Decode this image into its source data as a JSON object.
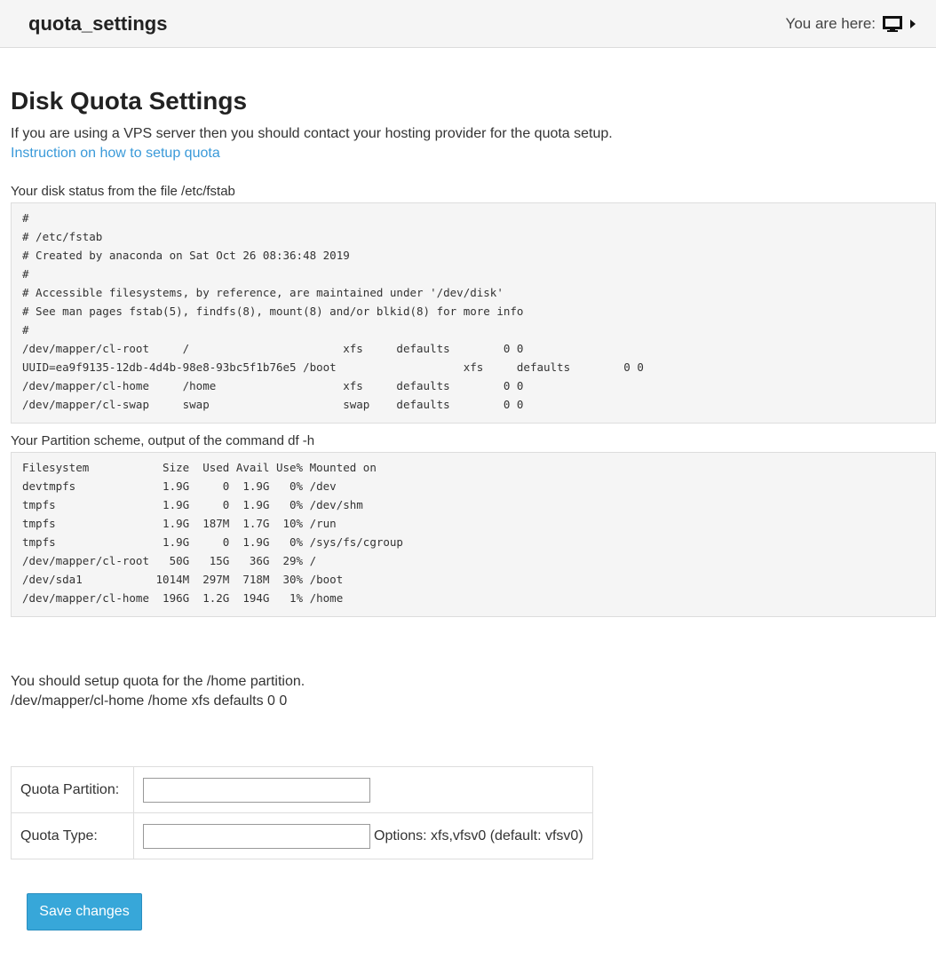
{
  "header": {
    "title": "quota_settings",
    "breadcrumb_label": "You are here:",
    "breadcrumb_icon": "desktop-icon",
    "breadcrumb_arrow_icon": "caret-right-icon"
  },
  "main": {
    "heading": "Disk Quota Settings",
    "intro": "If you are using a VPS server then you should contact your hosting provider for the quota setup.",
    "instruction_link": "Instruction on how to setup quota",
    "fstab_label": "Your disk status from the file /etc/fstab",
    "fstab_content": "#\n# /etc/fstab\n# Created by anaconda on Sat Oct 26 08:36:48 2019\n#\n# Accessible filesystems, by reference, are maintained under '/dev/disk'\n# See man pages fstab(5), findfs(8), mount(8) and/or blkid(8) for more info\n#\n/dev/mapper/cl-root     /                       xfs     defaults        0 0\nUUID=ea9f9135-12db-4d4b-98e8-93bc5f1b76e5 /boot                   xfs     defaults        0 0\n/dev/mapper/cl-home     /home                   xfs     defaults        0 0\n/dev/mapper/cl-swap     swap                    swap    defaults        0 0",
    "df_label": "Your Partition scheme, output of the command df -h",
    "df_content": "Filesystem           Size  Used Avail Use% Mounted on\ndevtmpfs             1.9G     0  1.9G   0% /dev\ntmpfs                1.9G     0  1.9G   0% /dev/shm\ntmpfs                1.9G  187M  1.7G  10% /run\ntmpfs                1.9G     0  1.9G   0% /sys/fs/cgroup\n/dev/mapper/cl-root   50G   15G   36G  29% /\n/dev/sda1           1014M  297M  718M  30% /boot\n/dev/mapper/cl-home  196G  1.2G  194G   1% /home",
    "advice_line1": "You should setup quota for the /home partition.",
    "advice_line2": "/dev/mapper/cl-home /home xfs defaults 0 0"
  },
  "form": {
    "partition_label": "Quota Partition:",
    "partition_value": "",
    "type_label": "Quota Type:",
    "type_value": "",
    "type_hint": "Options: xfs,vfsv0 (default: vfsv0)",
    "save_label": "Save changes"
  },
  "colors": {
    "accent": "#37a7d9",
    "link": "#3a9ad9"
  }
}
